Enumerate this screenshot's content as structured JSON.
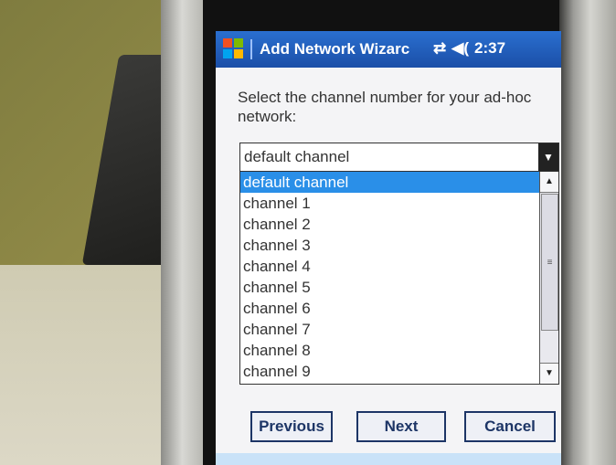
{
  "window": {
    "title": "Add Network Wizarc",
    "time": "2:37",
    "icons": [
      "windows-logo-icon",
      "network-connection-icon",
      "speaker-icon"
    ]
  },
  "main": {
    "prompt": "Select the channel number for your ad-hoc network:",
    "combo_value": "default channel",
    "dropdown_items": [
      "default channel",
      "channel 1",
      "channel 2",
      "channel 3",
      "channel 4",
      "channel 5",
      "channel 6",
      "channel 7",
      "channel 8",
      "channel 9"
    ],
    "selected_index": 0
  },
  "buttons": {
    "previous": "Previous",
    "next": "Next",
    "cancel": "Cancel"
  },
  "colors": {
    "titlebar": "#1b4fa8",
    "selection": "#2a8fe8"
  }
}
